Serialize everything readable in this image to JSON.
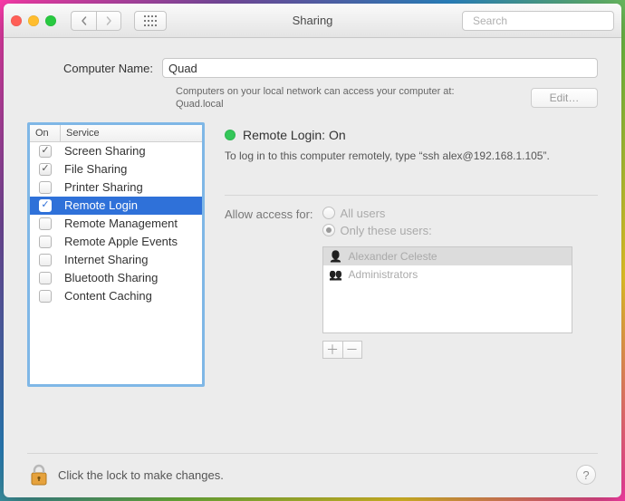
{
  "window": {
    "title": "Sharing",
    "search_placeholder": "Search"
  },
  "computer_name": {
    "label": "Computer Name:",
    "value": "Quad",
    "subtext_line1": "Computers on your local network can access your computer at:",
    "subtext_line2": "Quad.local",
    "edit_button": "Edit…"
  },
  "service_table": {
    "col_on": "On",
    "col_service": "Service",
    "items": [
      {
        "label": "Screen Sharing",
        "checked": true,
        "selected": false
      },
      {
        "label": "File Sharing",
        "checked": true,
        "selected": false
      },
      {
        "label": "Printer Sharing",
        "checked": false,
        "selected": false
      },
      {
        "label": "Remote Login",
        "checked": true,
        "selected": true
      },
      {
        "label": "Remote Management",
        "checked": false,
        "selected": false
      },
      {
        "label": "Remote Apple Events",
        "checked": false,
        "selected": false
      },
      {
        "label": "Internet Sharing",
        "checked": false,
        "selected": false
      },
      {
        "label": "Bluetooth Sharing",
        "checked": false,
        "selected": false
      },
      {
        "label": "Content Caching",
        "checked": false,
        "selected": false
      }
    ]
  },
  "detail": {
    "status_label": "Remote Login: On",
    "instruction": "To log in to this computer remotely, type “ssh alex@192.168.1.105”.",
    "access_label": "Allow access for:",
    "radio_all": "All users",
    "radio_only": "Only these users:",
    "users": [
      {
        "name": "Alexander Celeste",
        "icon": "person"
      },
      {
        "name": "Administrators",
        "icon": "group"
      }
    ]
  },
  "footer": {
    "lock_text": "Click the lock to make changes.",
    "help": "?"
  },
  "colors": {
    "selection": "#2f71d9",
    "focus_ring": "#7fb7e6",
    "status_green": "#34c759"
  }
}
